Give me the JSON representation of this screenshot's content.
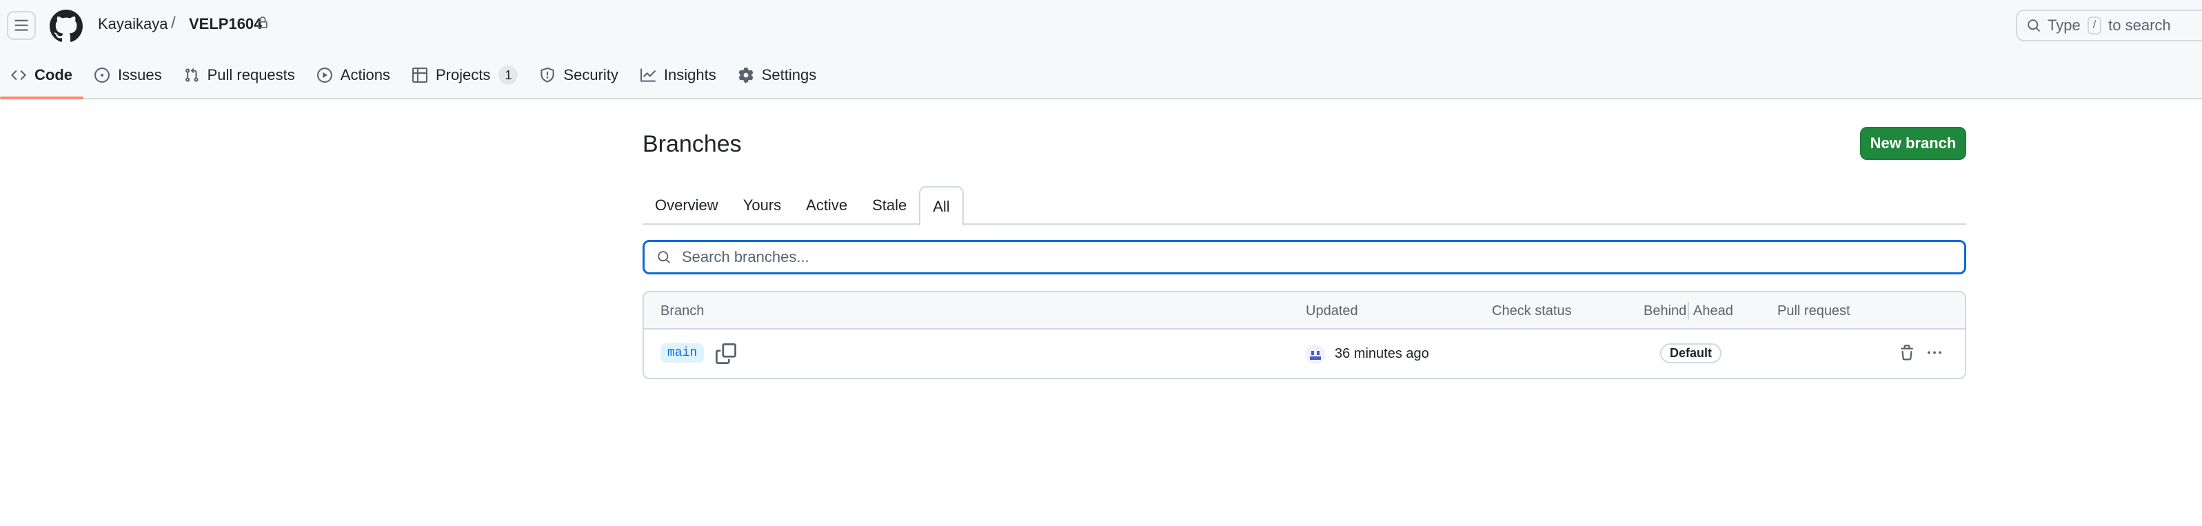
{
  "header": {
    "owner": "Kayaikaya",
    "separator": "/",
    "repo": "VELP1604",
    "search_placeholder_prefix": "Type",
    "search_key": "/",
    "search_placeholder_suffix": "to search"
  },
  "nav": {
    "items": [
      {
        "label": "Code",
        "icon": "code-icon",
        "active": true
      },
      {
        "label": "Issues",
        "icon": "issue-opened-icon"
      },
      {
        "label": "Pull requests",
        "icon": "git-pull-request-icon"
      },
      {
        "label": "Actions",
        "icon": "play-icon"
      },
      {
        "label": "Projects",
        "icon": "table-icon",
        "counter": "1"
      },
      {
        "label": "Security",
        "icon": "shield-icon"
      },
      {
        "label": "Insights",
        "icon": "graph-icon"
      },
      {
        "label": "Settings",
        "icon": "gear-icon"
      }
    ]
  },
  "page": {
    "title": "Branches",
    "new_branch_label": "New branch"
  },
  "tabs": [
    {
      "label": "Overview"
    },
    {
      "label": "Yours"
    },
    {
      "label": "Active"
    },
    {
      "label": "Stale"
    },
    {
      "label": "All",
      "selected": true
    }
  ],
  "search": {
    "placeholder": "Search branches..."
  },
  "table": {
    "columns": {
      "branch": "Branch",
      "updated": "Updated",
      "check_status": "Check status",
      "behind": "Behind",
      "ahead": "Ahead",
      "pull_request": "Pull request"
    },
    "rows": [
      {
        "branch": "main",
        "updated": "36 minutes ago",
        "badge": "Default"
      }
    ]
  },
  "colors": {
    "primary_button": "#1f883d",
    "active_tab_underline": "#fd8c73",
    "focus_border": "#0969da",
    "branch_chip_bg": "#ddf4ff"
  }
}
